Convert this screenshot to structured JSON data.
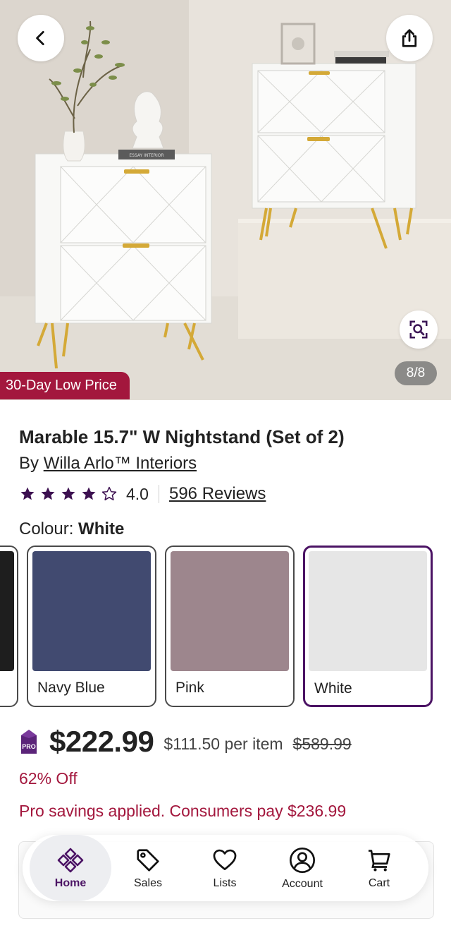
{
  "hero": {
    "image_counter": "8/8",
    "promo_badge": "30-Day Low Price",
    "book_spine_text": "ESSAY INTERIOR"
  },
  "product": {
    "title": "Marable 15.7\" W Nightstand (Set of 2)",
    "by_prefix": "By",
    "brand": "Willa Arlo™ Interiors",
    "rating": "4.0",
    "rating_stars": 4,
    "rating_max": 5,
    "reviews": "596 Reviews",
    "colour_label": "Colour:",
    "colour_selected": "White",
    "swatches": [
      {
        "name": "Black",
        "color": "#1e1e1e"
      },
      {
        "name": "Navy Blue",
        "color": "#414a70"
      },
      {
        "name": "Pink",
        "color": "#9d868d"
      },
      {
        "name": "White",
        "color": "#e6e6e6"
      }
    ],
    "pro_badge": "PRO",
    "price": "$222.99",
    "per_item": "$111.50 per item",
    "original_price": "$589.99",
    "discount": "62% Off",
    "pro_savings": "Pro savings applied. Consumers pay $236.99"
  },
  "nav": {
    "items": [
      {
        "label": "Home",
        "icon": "home-icon",
        "active": true
      },
      {
        "label": "Sales",
        "icon": "tag-icon",
        "active": false
      },
      {
        "label": "Lists",
        "icon": "heart-icon",
        "active": false
      },
      {
        "label": "Account",
        "icon": "account-icon",
        "active": false
      },
      {
        "label": "Cart",
        "icon": "cart-icon",
        "active": false
      }
    ]
  },
  "colors": {
    "accent_purple": "#4b1364",
    "sale_red": "#a3173d",
    "star": "#3c1050"
  }
}
